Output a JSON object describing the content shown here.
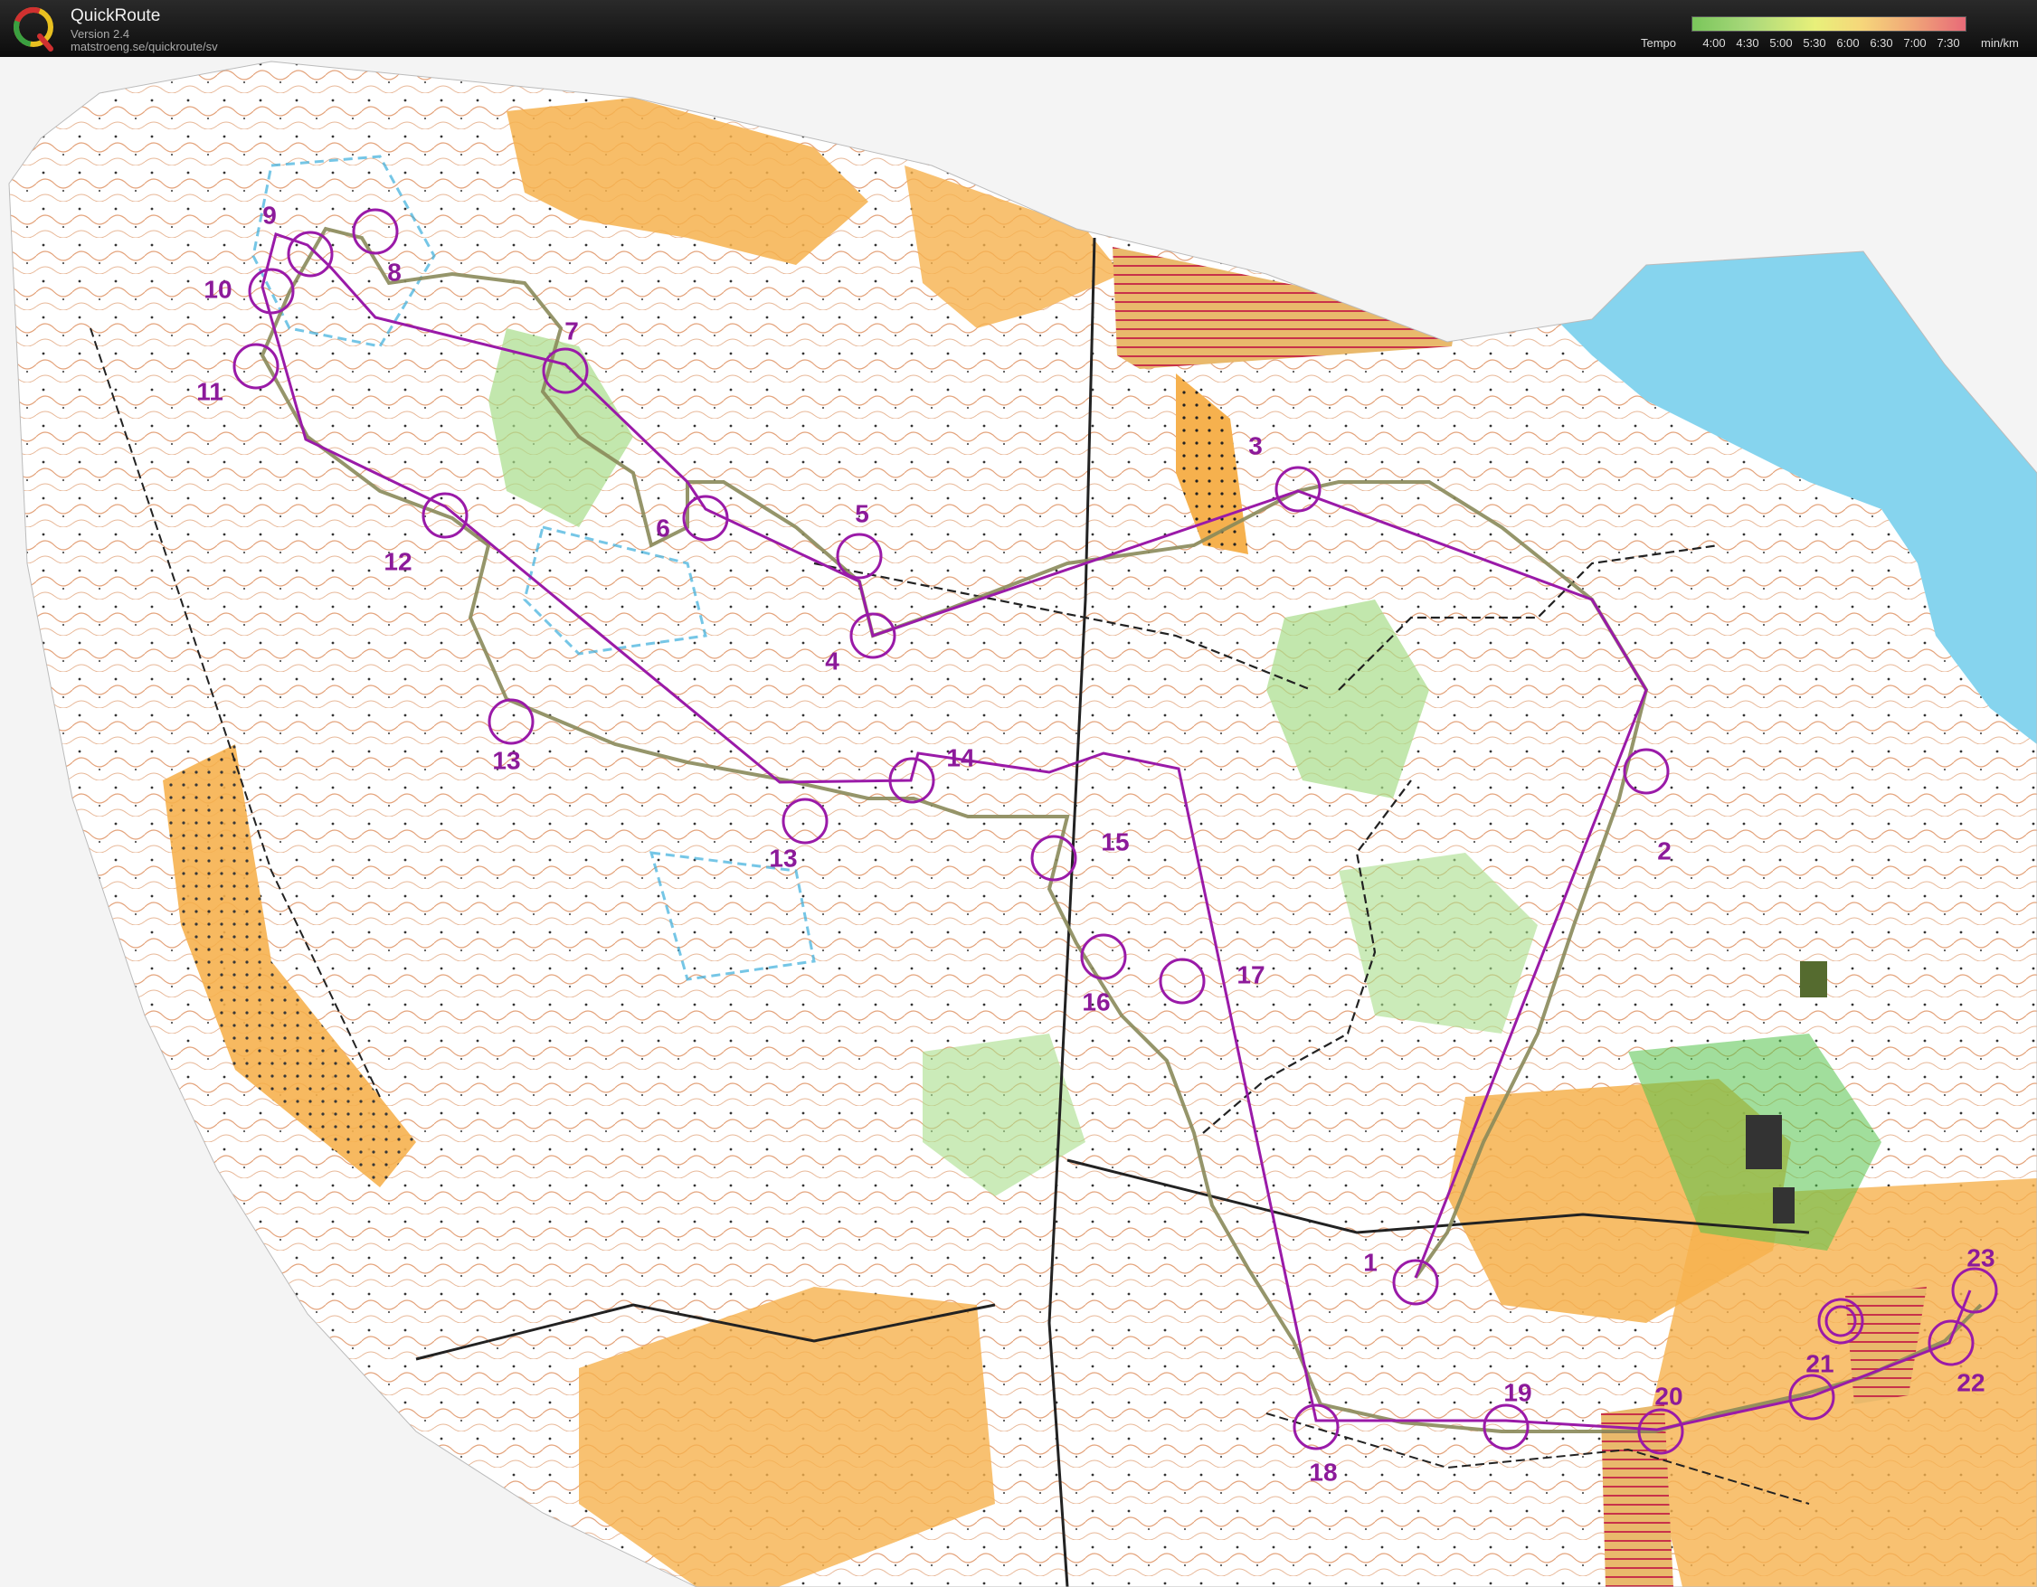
{
  "app": {
    "name": "QuickRoute",
    "version": "Version 2.4",
    "url": "matstroeng.se/quickroute/sv"
  },
  "tempo_legend": {
    "label": "Tempo",
    "ticks": [
      "4:00",
      "4:30",
      "5:00",
      "5:30",
      "6:00",
      "6:30",
      "7:00",
      "7:30"
    ],
    "unit": "min/km",
    "colors": [
      "#7ac65b",
      "#a8d87a",
      "#e8f07a",
      "#f6d67a",
      "#f0a878",
      "#e86a78"
    ]
  },
  "map": {
    "course_color": "#9a1aa8",
    "route_color": "#8a8a5a",
    "water_color": "#86d4ee",
    "open_land_color": "#f6b14e",
    "forest_color": "#ffffff",
    "green_color": "#a8dd8a",
    "controls": [
      {
        "label": "1"
      },
      {
        "label": "2"
      },
      {
        "label": "3"
      },
      {
        "label": "4"
      },
      {
        "label": "5"
      },
      {
        "label": "6"
      },
      {
        "label": "7"
      },
      {
        "label": "8"
      },
      {
        "label": "9"
      },
      {
        "label": "10"
      },
      {
        "label": "11"
      },
      {
        "label": "12"
      },
      {
        "label": "13"
      },
      {
        "label": "13"
      },
      {
        "label": "14"
      },
      {
        "label": "15"
      },
      {
        "label": "16"
      },
      {
        "label": "17"
      },
      {
        "label": "18"
      },
      {
        "label": "19"
      },
      {
        "label": "20"
      },
      {
        "label": "21"
      },
      {
        "label": "22"
      },
      {
        "label": "23"
      }
    ]
  }
}
